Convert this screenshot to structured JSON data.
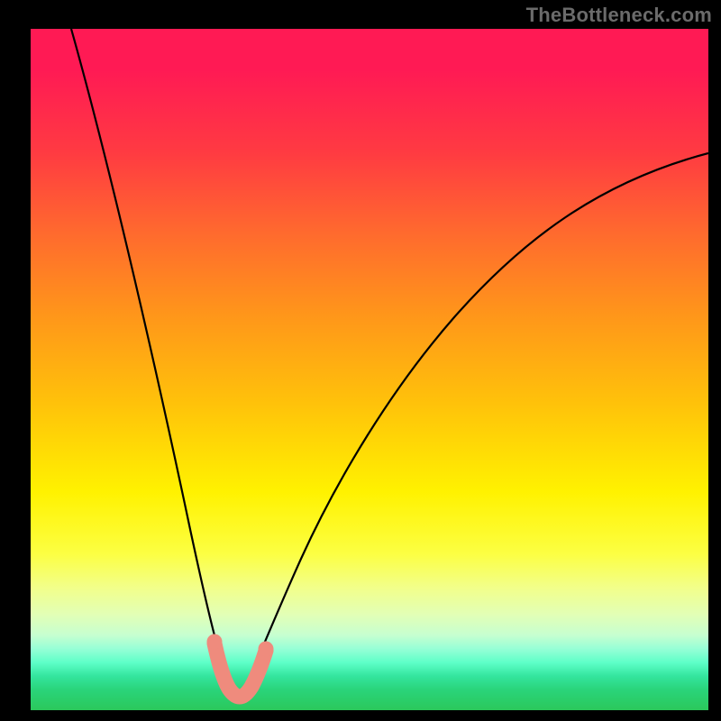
{
  "watermark": {
    "text": "TheBottleneck.com"
  },
  "chart_data": {
    "type": "line",
    "title": "",
    "xlabel": "",
    "ylabel": "",
    "xlim": [
      0,
      100
    ],
    "ylim": [
      0,
      100
    ],
    "grid": false,
    "legend": false,
    "gradient_stops": [
      {
        "pct": 0,
        "color": "#ff1a54"
      },
      {
        "pct": 18,
        "color": "#ff3a42"
      },
      {
        "pct": 30,
        "color": "#ff6a2e"
      },
      {
        "pct": 42,
        "color": "#ff961a"
      },
      {
        "pct": 55,
        "color": "#ffc20a"
      },
      {
        "pct": 68,
        "color": "#fff200"
      },
      {
        "pct": 82,
        "color": "#f2ff8a"
      },
      {
        "pct": 90,
        "color": "#96ffd6"
      },
      {
        "pct": 100,
        "color": "#2bc85b"
      }
    ],
    "series": [
      {
        "name": "bottleneck-curve",
        "color": "#000000",
        "x": [
          6,
          10,
          14,
          18,
          22,
          24,
          26,
          27,
          28,
          29,
          30,
          31,
          33,
          36,
          40,
          46,
          54,
          64,
          76,
          90,
          100
        ],
        "y": [
          100,
          82,
          64,
          46,
          28,
          19,
          11,
          6,
          3,
          2,
          2,
          3,
          6,
          12,
          21,
          33,
          46,
          58,
          68,
          75,
          79
        ]
      }
    ],
    "markers": [
      {
        "name": "highlight-segment",
        "color": "#f08878",
        "shape": "round-capped-path",
        "x": [
          26.2,
          27.0,
          27.8,
          28.6,
          29.6,
          30.4,
          31.2,
          32.0
        ],
        "y": [
          8.0,
          4.2,
          2.6,
          2.0,
          2.0,
          2.8,
          4.8,
          8.2
        ]
      }
    ]
  }
}
